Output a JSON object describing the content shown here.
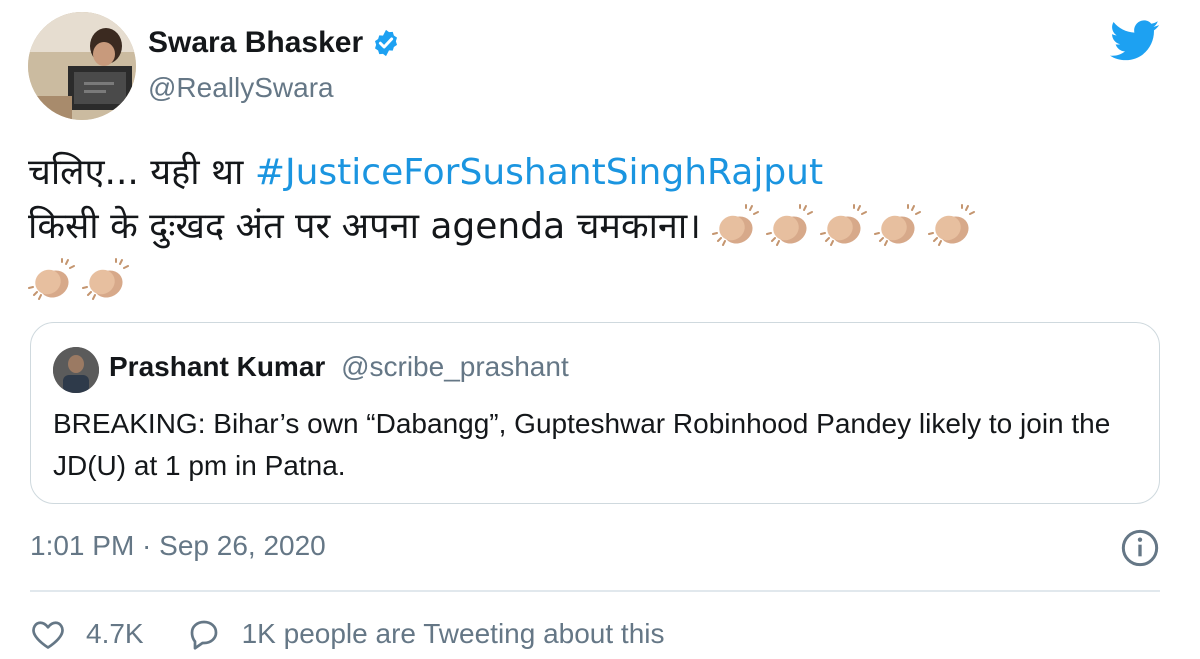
{
  "author": {
    "name": "Swara Bhasker",
    "handle": "@ReallySwara",
    "verified_icon": "verified-badge-icon",
    "avatar_icon": "profile-photo"
  },
  "brand": {
    "icon": "twitter-bird-icon",
    "color": "#1DA1F2"
  },
  "tweet": {
    "line1_prefix": "चलिए... यही था ",
    "hashtag": "#JusticeForSushantSinghRajput",
    "line2": "किसी के दुःखद अंत पर अपना agenda चमकाना।",
    "clap_count": 7,
    "clap_icon": "clapping-hands-emoji"
  },
  "quoted_tweet": {
    "name": "Prashant Kumar",
    "handle": "@scribe_prashant",
    "text": "BREAKING: Bihar’s own “Dabangg”, Gupteshwar Robinhood Pandey likely to join the JD(U) at 1 pm in Patna."
  },
  "meta": {
    "timestamp": "1:01 PM · Sep 26, 2020",
    "info_icon": "info-icon"
  },
  "actions": {
    "likes": "4.7K",
    "like_icon": "heart-icon",
    "tweeting_text": "1K people are Tweeting about this",
    "reply_icon": "speech-bubble-icon"
  },
  "colors": {
    "link": "#1B95E0",
    "secondary_text": "#657786",
    "border": "#CFD9DE"
  }
}
